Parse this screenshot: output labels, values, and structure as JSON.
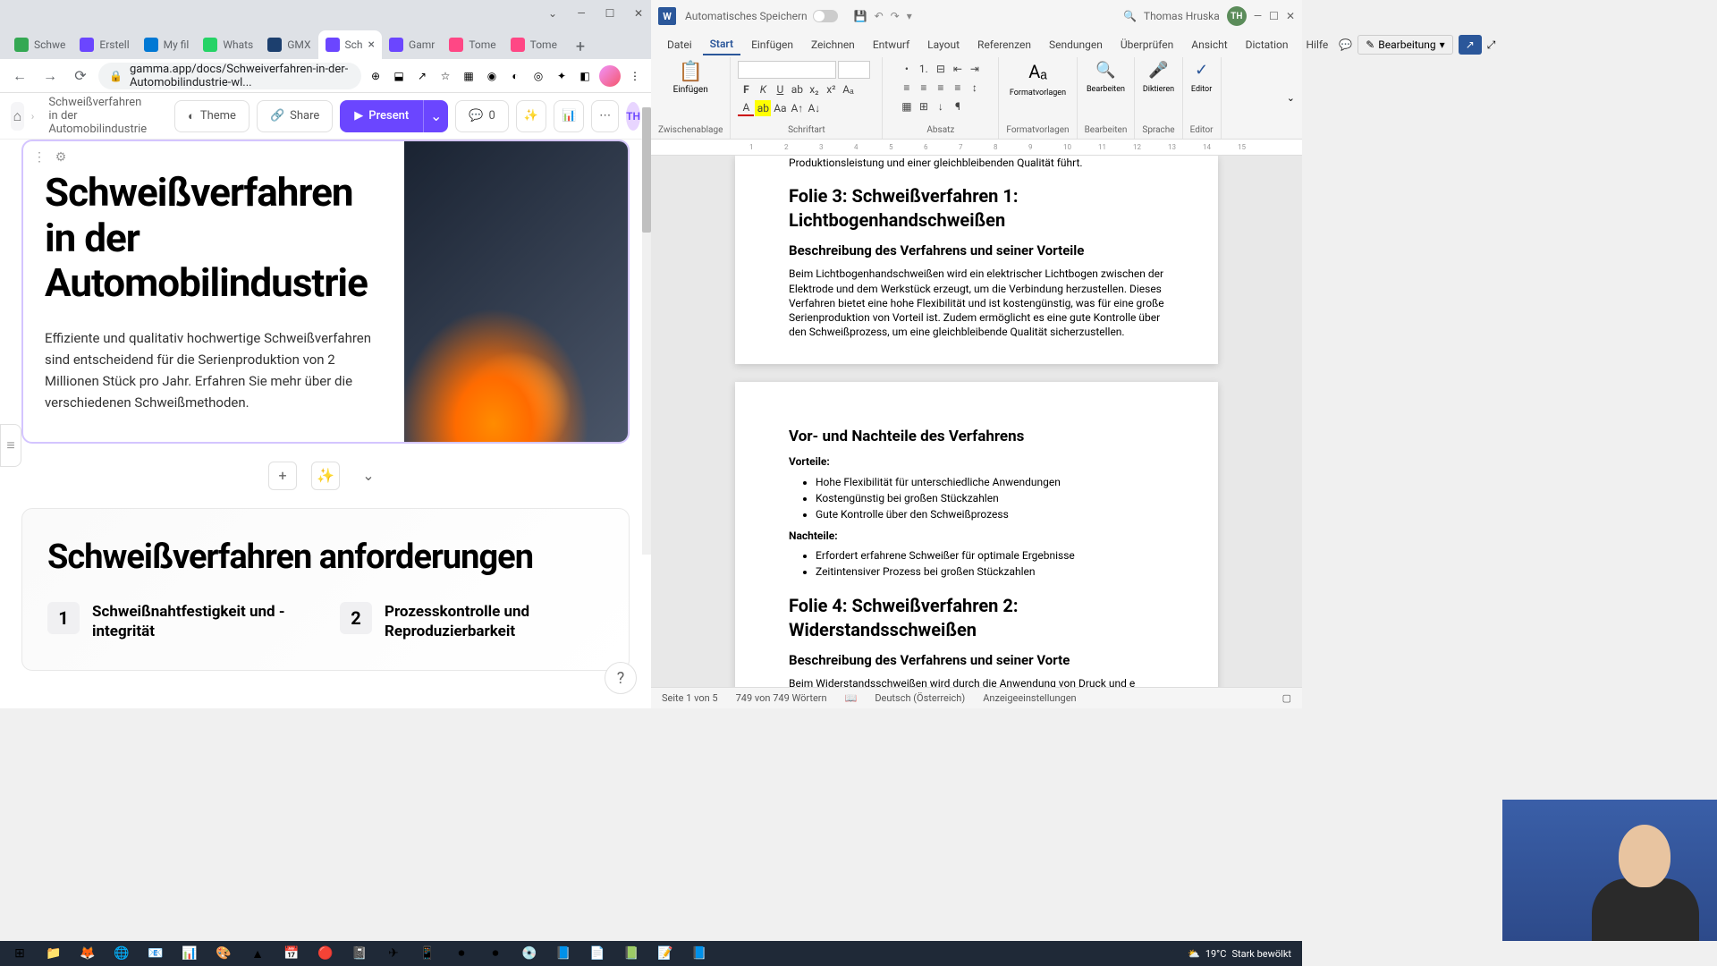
{
  "browser": {
    "tabs": [
      {
        "label": "Schwe",
        "icon_bg": "#34a853"
      },
      {
        "label": "Erstell",
        "icon_bg": "#6b46ff"
      },
      {
        "label": "My fil",
        "icon_bg": "#0078d4"
      },
      {
        "label": "Whats",
        "icon_bg": "#25d366"
      },
      {
        "label": "GMX",
        "icon_bg": "#1c3f6e"
      },
      {
        "label": "Sch",
        "icon_bg": "#6b46ff",
        "active": true
      },
      {
        "label": "Gamr",
        "icon_bg": "#6b46ff"
      },
      {
        "label": "Tome",
        "icon_bg": "#ff4785"
      },
      {
        "label": "Tome",
        "icon_bg": "#ff4785"
      }
    ],
    "url": "gamma.app/docs/Schweiverfahren-in-der-Automobilindustrie-wl..."
  },
  "gamma": {
    "breadcrumb": "Schweißverfahren in der Automobilindustrie",
    "theme_label": "Theme",
    "share_label": "Share",
    "present_label": "Present",
    "comments_count": "0",
    "user_initials": "TH",
    "card1": {
      "title": "Schweißverfahren in der Automobilindustrie",
      "body": "Effiziente und qualitativ hochwertige Schweißverfahren sind entscheidend für die Serienproduktion von 2 Millionen Stück pro Jahr. Erfahren Sie mehr über die verschiedenen Schweißmethoden."
    },
    "card2": {
      "title": "Schweißverfahren anforderungen",
      "items": [
        {
          "num": "1",
          "text": "Schweißnahtfestigkeit und -integrität"
        },
        {
          "num": "2",
          "text": "Prozesskontrolle und Reproduzierbarkeit"
        }
      ]
    }
  },
  "word": {
    "autosave_label": "Automatisches Speichern",
    "user_name": "Thomas Hruska",
    "user_initials": "TH",
    "ribbon_tabs": [
      "Datei",
      "Start",
      "Einfügen",
      "Zeichnen",
      "Entwurf",
      "Layout",
      "Referenzen",
      "Sendungen",
      "Überprüfen",
      "Ansicht",
      "Dictation",
      "Hilfe"
    ],
    "active_tab": "Start",
    "bearbeitung_label": "Bearbeitung",
    "groups": {
      "clipboard": "Zwischenablage",
      "paste": "Einfügen",
      "font": "Schriftart",
      "paragraph": "Absatz",
      "styles": "Formatvorlagen",
      "styles_btn": "Formatvorlagen",
      "edit": "Bearbeiten",
      "dictate": "Diktieren",
      "language": "Sprache",
      "editor": "Editor"
    },
    "doc": {
      "truncated_top": "Produktionsleistung und einer gleichbleibenden Qualität führt.",
      "folie3_title": "Folie 3: Schweißverfahren 1: Lichtbogenhandschweißen",
      "folie3_sub": "Beschreibung des Verfahrens und seiner Vorteile",
      "folie3_body": "Beim Lichtbogenhandschweißen wird ein elektrischer Lichtbogen zwischen der Elektrode und dem Werkstück erzeugt, um die Verbindung herzustellen. Dieses Verfahren bietet eine hohe Flexibilität und ist kostengünstig, was für eine große Serienproduktion von Vorteil ist. Zudem ermöglicht es eine gute Kontrolle über den Schweißprozess, um eine gleichbleibende Qualität sicherzustellen.",
      "vn_title": "Vor- und Nachteile des Verfahrens",
      "vorteile_label": "Vorteile:",
      "vorteile": [
        "Hohe Flexibilität für unterschiedliche Anwendungen",
        "Kostengünstig bei großen Stückzahlen",
        "Gute Kontrolle über den Schweißprozess"
      ],
      "nachteile_label": "Nachteile:",
      "nachteile": [
        "Erfordert erfahrene Schweißer für optimale Ergebnisse",
        "Zeitintensiver Prozess bei großen Stückzahlen"
      ],
      "folie4_title": "Folie 4: Schweißverfahren 2: Widerstandsschweißen",
      "folie4_sub": "Beschreibung des Verfahrens und seiner Vorte",
      "folie4_body": "Beim Widerstandsschweißen wird durch die Anwendung von Druck und e"
    },
    "status": {
      "page": "Seite 1 von 5",
      "words": "749 von 749 Wörtern",
      "lang": "Deutsch (Österreich)",
      "display": "Anzeigeeinstellungen"
    }
  },
  "taskbar": {
    "weather_temp": "19°C",
    "weather_desc": "Stark bewölkt"
  }
}
